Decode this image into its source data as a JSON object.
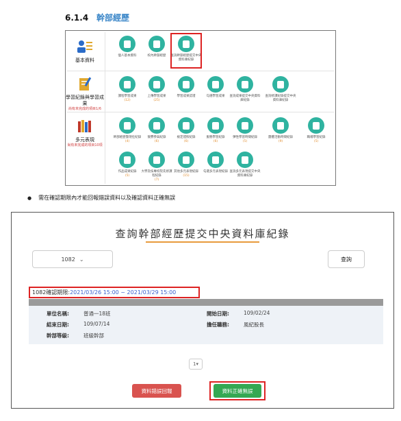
{
  "section": {
    "number": "6.1.4",
    "title": "幹部經歷"
  },
  "top_panel": {
    "categories": [
      {
        "label": "基本資料",
        "sub": ""
      },
      {
        "label": "學習紀錄與學習成果",
        "sub": "尚有未完成的項目1/6"
      },
      {
        "label": "多元表現",
        "sub": "尚有未完成的項目10項"
      }
    ],
    "row1": [
      {
        "label": "個人基本資料",
        "count": ""
      },
      {
        "label": "校內幹部經歷",
        "count": ""
      },
      {
        "label": "查詢幹部經歷提交中央資料庫紀錄",
        "count": ""
      }
    ],
    "row2": [
      {
        "label": "課程學習成果",
        "count": "(12)"
      },
      {
        "label": "上傳學習成果",
        "count": "(25)"
      },
      {
        "label": "學習成果認證",
        "count": ""
      },
      {
        "label": "勾選學習成果",
        "count": ""
      },
      {
        "label": "查詢成果提交中央資料庫紀錄",
        "count": ""
      },
      {
        "label": "查詢修課紀錄提交中央資料庫紀錄",
        "count": ""
      }
    ],
    "row3": [
      {
        "label": "幹部經歷暨現任紀錄",
        "count": "(4)"
      },
      {
        "label": "競賽參與紀錄",
        "count": "(6)"
      },
      {
        "label": "檢定證照紀錄",
        "count": "(6)"
      },
      {
        "label": "服務學習紀錄",
        "count": "(6)"
      },
      {
        "label": "彈性學習時間紀錄",
        "count": "(5)"
      },
      {
        "label": "團體活動時間紀錄",
        "count": "(9)"
      },
      {
        "label": "職場學習紀錄",
        "count": "(5)"
      }
    ],
    "row4": [
      {
        "label": "作品成果紀錄",
        "count": "(5)"
      },
      {
        "label": "大學及技專校院先修課程紀錄",
        "count": "(7)"
      },
      {
        "label": "其他多元表現紀錄",
        "count": "(15)"
      },
      {
        "label": "勾選多元表現紀錄",
        "count": ""
      },
      {
        "label": "查詢多元表現提交中央資料庫紀錄",
        "count": ""
      }
    ]
  },
  "bullet": "需在確認期限內才能回報錯誤資料以及確認資料正確無誤",
  "screen": {
    "title": "查詢幹部經歷提交中央資料庫紀錄",
    "select_value": "1082",
    "query_label": "查詢",
    "period_label": "1082確認期限:",
    "period_value": "2021/03/26 15:00 ~ 2021/03/29 15:00",
    "fields": {
      "unit_k": "單位名稱:",
      "unit_v": "普通一18班",
      "start_k": "開始日期:",
      "start_v": "109/02/24",
      "end_k": "結束日期:",
      "end_v": "109/07/14",
      "role_k": "擔任職務:",
      "role_v": "風紀股長",
      "level_k": "幹部等級:",
      "level_v": "班級幹部"
    },
    "page": "1",
    "report_label": "資料錯誤回報",
    "confirm_label": "資料正確無誤"
  },
  "colors": {
    "teal": "#2fb3a0",
    "red": "#d9534f",
    "green": "#34a853",
    "orange": "#e89a3c",
    "blue": "#3a5fcd"
  }
}
